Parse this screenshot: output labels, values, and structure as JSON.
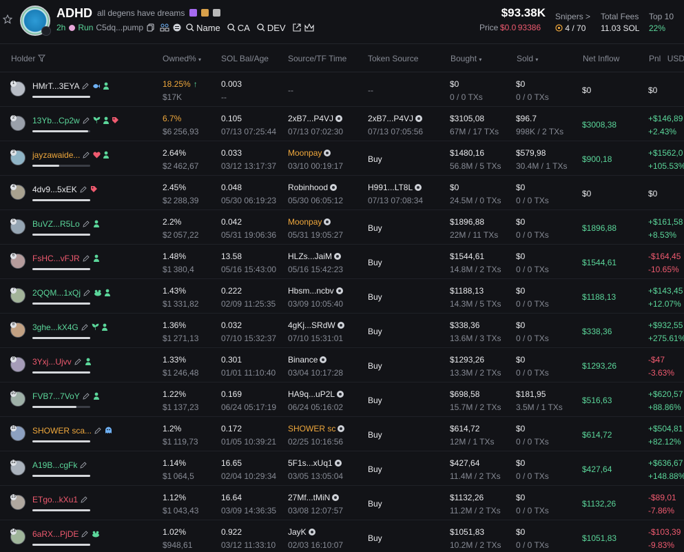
{
  "token": {
    "name": "ADHD",
    "tagline": "all degens have dreams",
    "age": "2h",
    "run_label": "Run",
    "contract": "C5dq...pump",
    "links": [
      "Name",
      "CA",
      "DEV"
    ],
    "market_cap": "$93.38K",
    "price_label": "Price",
    "price_value": "$0.0 93386",
    "snipers_label": "Snipers >",
    "snipers_value": "4 / 70",
    "fees_label": "Total Fees",
    "fees_value": "11.03 SOL",
    "top10_label": "Top 10",
    "top10_value": "22%"
  },
  "columns": {
    "holder": "Holder",
    "owned": "Owned%",
    "sol": "SOL Bal/Age",
    "source": "Source/TF Time",
    "token_source": "Token Source",
    "bought": "Bought",
    "sold": "Sold",
    "inflow": "Net Inflow",
    "pnl": "Pnl",
    "usd": "USD"
  },
  "colors": {
    "positive": "#5bd69a",
    "negative": "#ef5a6f",
    "accent": "#f0a83c"
  },
  "holders": [
    {
      "rank": "1",
      "name": "HMrT...3EYA",
      "name_color": "white",
      "tags": [
        "fish-icon",
        "person-icon"
      ],
      "pct": "18.25%",
      "pct_color": "orange",
      "trend": "↑",
      "usd": "$17K",
      "sol": "0.003",
      "age": "--",
      "src": "--",
      "src_color": "",
      "src_coin": false,
      "src_time": "",
      "tsrc": "--",
      "tsrc_coin": false,
      "tsrc_time": "",
      "bought": "$0",
      "btx": "0 / 0 TXs",
      "sold": "$0",
      "stx": "0 / 0 TXs",
      "inflow": "$0",
      "inflow_color": "white",
      "pnl": "$0",
      "pnl_pct": "",
      "pnl_color": "white",
      "bar": 1.0
    },
    {
      "rank": "2",
      "name": "13Yb...Cp2w",
      "name_color": "pos",
      "tags": [
        "plant-icon",
        "person-icon",
        "tag-icon"
      ],
      "pct": "6.7%",
      "pct_color": "orange",
      "trend": "",
      "usd": "$6 256,93",
      "sol": "0.105",
      "age": "07/13 07:25:44",
      "src": "2xB7...P4VJ",
      "src_color": "",
      "src_coin": true,
      "src_time": "07/13 07:02:30",
      "tsrc": "2xB7...P4VJ",
      "tsrc_coin": true,
      "tsrc_time": "07/13 07:05:56",
      "bought": "$3105,08",
      "btx": "67M / 17 TXs",
      "sold": "$96.7",
      "stx": "998K / 2 TXs",
      "inflow": "$3008,38",
      "inflow_color": "pos",
      "pnl": "+$146,89",
      "pnl_pct": "+2.43%",
      "pnl_color": "pos",
      "bar": 0.96
    },
    {
      "rank": "3",
      "name": "jayzawaide...",
      "name_color": "orange",
      "tags": [
        "heart-icon",
        "person-icon"
      ],
      "pct": "2.64%",
      "pct_color": "white",
      "trend": "",
      "usd": "$2 462,67",
      "sol": "0.033",
      "age": "03/12 13:17:37",
      "src": "Moonpay",
      "src_color": "orange",
      "src_coin": true,
      "src_time": "03/10 00:19:17",
      "tsrc": "Buy",
      "tsrc_coin": false,
      "tsrc_time": "",
      "bought": "$1480,16",
      "btx": "56.8M / 5 TXs",
      "sold": "$579,98",
      "stx": "30.4M / 1 TXs",
      "inflow": "$900,18",
      "inflow_color": "pos",
      "pnl": "+$1562,0",
      "pnl_pct": "+105.53%",
      "pnl_color": "pos",
      "bar": 0.46
    },
    {
      "rank": "4",
      "name": "4dv9...5xEK",
      "name_color": "white",
      "tags": [
        "tag-icon"
      ],
      "pct": "2.45%",
      "pct_color": "white",
      "trend": "",
      "usd": "$2 288,39",
      "sol": "0.048",
      "age": "05/30 06:19:23",
      "src": "Robinhood",
      "src_color": "",
      "src_coin": true,
      "src_time": "05/30 06:05:12",
      "tsrc": "H991...LT8L",
      "tsrc_coin": true,
      "tsrc_time": "07/13 07:08:34",
      "bought": "$0",
      "btx": "24.5M / 0 TXs",
      "sold": "$0",
      "stx": "0 / 0 TXs",
      "inflow": "$0",
      "inflow_color": "white",
      "pnl": "$0",
      "pnl_pct": "",
      "pnl_color": "white",
      "bar": 1.0
    },
    {
      "rank": "5",
      "name": "BuVZ...R5Lo",
      "name_color": "pos",
      "tags": [
        "person-icon"
      ],
      "pct": "2.2%",
      "pct_color": "white",
      "trend": "",
      "usd": "$2 057,22",
      "sol": "0.042",
      "age": "05/31 19:06:36",
      "src": "Moonpay",
      "src_color": "orange",
      "src_coin": true,
      "src_time": "05/31 19:05:27",
      "tsrc": "Buy",
      "tsrc_coin": false,
      "tsrc_time": "",
      "bought": "$1896,88",
      "btx": "22M / 11 TXs",
      "sold": "$0",
      "stx": "0 / 0 TXs",
      "inflow": "$1896,88",
      "inflow_color": "pos",
      "pnl": "+$161,58",
      "pnl_pct": "+8.53%",
      "pnl_color": "pos",
      "bar": 1.0
    },
    {
      "rank": "6",
      "name": "FsHC...vFJR",
      "name_color": "neg",
      "tags": [
        "person-icon"
      ],
      "pct": "1.48%",
      "pct_color": "white",
      "trend": "",
      "usd": "$1 380,4",
      "sol": "13.58",
      "age": "05/16 15:43:00",
      "src": "HLZs...JaiM",
      "src_color": "",
      "src_coin": true,
      "src_time": "05/16 15:42:23",
      "tsrc": "Buy",
      "tsrc_coin": false,
      "tsrc_time": "",
      "bought": "$1544,61",
      "btx": "14.8M / 2 TXs",
      "sold": "$0",
      "stx": "0 / 0 TXs",
      "inflow": "$1544,61",
      "inflow_color": "pos",
      "pnl": "-$164,45",
      "pnl_pct": "-10.65%",
      "pnl_color": "neg",
      "bar": 1.0
    },
    {
      "rank": "7",
      "name": "2QQM...1xQj",
      "name_color": "pos",
      "tags": [
        "frog-icon",
        "person-icon"
      ],
      "pct": "1.43%",
      "pct_color": "white",
      "trend": "",
      "usd": "$1 331,82",
      "sol": "0.222",
      "age": "02/09 11:25:35",
      "src": "Hbsm...ncbv",
      "src_color": "",
      "src_coin": true,
      "src_time": "03/09 10:05:40",
      "tsrc": "Buy",
      "tsrc_coin": false,
      "tsrc_time": "",
      "bought": "$1188,13",
      "btx": "14.3M / 5 TXs",
      "sold": "$0",
      "stx": "0 / 0 TXs",
      "inflow": "$1188,13",
      "inflow_color": "pos",
      "pnl": "+$143,45",
      "pnl_pct": "+12.07%",
      "pnl_color": "pos",
      "bar": 1.0
    },
    {
      "rank": "8",
      "name": "3ghe...kX4G",
      "name_color": "pos",
      "tags": [
        "plant-icon",
        "person-icon"
      ],
      "pct": "1.36%",
      "pct_color": "white",
      "trend": "",
      "usd": "$1 271,13",
      "sol": "0.032",
      "age": "07/10 15:32:37",
      "src": "4gKj...SRdW",
      "src_color": "",
      "src_coin": true,
      "src_time": "07/10 15:31:01",
      "tsrc": "Buy",
      "tsrc_coin": false,
      "tsrc_time": "",
      "bought": "$338,36",
      "btx": "13.6M / 3 TXs",
      "sold": "$0",
      "stx": "0 / 0 TXs",
      "inflow": "$338,36",
      "inflow_color": "pos",
      "pnl": "+$932,55",
      "pnl_pct": "+275.61%",
      "pnl_color": "pos",
      "bar": 1.0
    },
    {
      "rank": "9",
      "name": "3Yxj...Ujvv",
      "name_color": "neg",
      "tags": [
        "person-icon"
      ],
      "pct": "1.33%",
      "pct_color": "white",
      "trend": "",
      "usd": "$1 246,48",
      "sol": "0.301",
      "age": "01/01 11:10:40",
      "src": "Binance",
      "src_color": "",
      "src_coin": true,
      "src_time": "03/04 10:17:28",
      "tsrc": "Buy",
      "tsrc_coin": false,
      "tsrc_time": "",
      "bought": "$1293,26",
      "btx": "13.3M / 2 TXs",
      "sold": "$0",
      "stx": "0 / 0 TXs",
      "inflow": "$1293,26",
      "inflow_color": "pos",
      "pnl": "-$47",
      "pnl_pct": "-3.63%",
      "pnl_color": "neg",
      "bar": 1.0
    },
    {
      "rank": "10",
      "name": "FVB7...7VoY",
      "name_color": "pos",
      "tags": [
        "person-icon"
      ],
      "pct": "1.22%",
      "pct_color": "white",
      "trend": "",
      "usd": "$1 137,23",
      "sol": "0.169",
      "age": "06/24 05:17:19",
      "src": "HA9q...uP2L",
      "src_color": "",
      "src_coin": true,
      "src_time": "06/24 05:16:02",
      "tsrc": "Buy",
      "tsrc_coin": false,
      "tsrc_time": "",
      "bought": "$698,58",
      "btx": "15.7M / 2 TXs",
      "sold": "$181,95",
      "stx": "3.5M / 1 TXs",
      "inflow": "$516,63",
      "inflow_color": "pos",
      "pnl": "+$620,57",
      "pnl_pct": "+88.86%",
      "pnl_color": "pos",
      "bar": 0.76
    },
    {
      "rank": "11",
      "name": "SHOWER sca...",
      "name_color": "orange",
      "tags": [
        "ghost-icon"
      ],
      "pct": "1.2%",
      "pct_color": "white",
      "trend": "",
      "usd": "$1 119,73",
      "sol": "0.172",
      "age": "01/05 10:39:21",
      "src": "SHOWER sc",
      "src_color": "orange",
      "src_coin": true,
      "src_time": "02/25 10:16:56",
      "tsrc": "Buy",
      "tsrc_coin": false,
      "tsrc_time": "",
      "bought": "$614,72",
      "btx": "12M / 1 TXs",
      "sold": "$0",
      "stx": "0 / 0 TXs",
      "inflow": "$614,72",
      "inflow_color": "pos",
      "pnl": "+$504,81",
      "pnl_pct": "+82.12%",
      "pnl_color": "pos",
      "bar": 1.0
    },
    {
      "rank": "12",
      "name": "A19B...cgFk",
      "name_color": "pos",
      "tags": [],
      "pct": "1.14%",
      "pct_color": "white",
      "trend": "",
      "usd": "$1 064,5",
      "sol": "16.65",
      "age": "02/04 10:29:34",
      "src": "5F1s...xUq1",
      "src_color": "",
      "src_coin": true,
      "src_time": "03/05 13:05:04",
      "tsrc": "Buy",
      "tsrc_coin": false,
      "tsrc_time": "",
      "bought": "$427,64",
      "btx": "11.4M / 2 TXs",
      "sold": "$0",
      "stx": "0 / 0 TXs",
      "inflow": "$427,64",
      "inflow_color": "pos",
      "pnl": "+$636,67",
      "pnl_pct": "+148.88%",
      "pnl_color": "pos",
      "bar": 1.0
    },
    {
      "rank": "13",
      "name": "ETgo...kXu1",
      "name_color": "neg",
      "tags": [],
      "pct": "1.12%",
      "pct_color": "white",
      "trend": "",
      "usd": "$1 043,43",
      "sol": "16.64",
      "age": "03/09 14:36:35",
      "src": "27Mf...tMiN",
      "src_color": "",
      "src_coin": true,
      "src_time": "03/08 12:07:57",
      "tsrc": "Buy",
      "tsrc_coin": false,
      "tsrc_time": "",
      "bought": "$1132,26",
      "btx": "11.2M / 2 TXs",
      "sold": "$0",
      "stx": "0 / 0 TXs",
      "inflow": "$1132,26",
      "inflow_color": "pos",
      "pnl": "-$89,01",
      "pnl_pct": "-7.86%",
      "pnl_color": "neg",
      "bar": 1.0
    },
    {
      "rank": "14",
      "name": "6aRX...PjDE",
      "name_color": "neg",
      "tags": [
        "frog-icon"
      ],
      "pct": "1.02%",
      "pct_color": "white",
      "trend": "",
      "usd": "$948,61",
      "sol": "0.922",
      "age": "03/12 11:33:10",
      "src": "JayK",
      "src_color": "",
      "src_coin": true,
      "src_time": "02/03 16:10:07",
      "tsrc": "Buy",
      "tsrc_coin": false,
      "tsrc_time": "",
      "bought": "$1051,83",
      "btx": "10.2M / 2 TXs",
      "sold": "$0",
      "stx": "0 / 0 TXs",
      "inflow": "$1051,83",
      "inflow_color": "pos",
      "pnl": "-$103,39",
      "pnl_pct": "-9.83%",
      "pnl_color": "neg",
      "bar": 1.0
    }
  ]
}
